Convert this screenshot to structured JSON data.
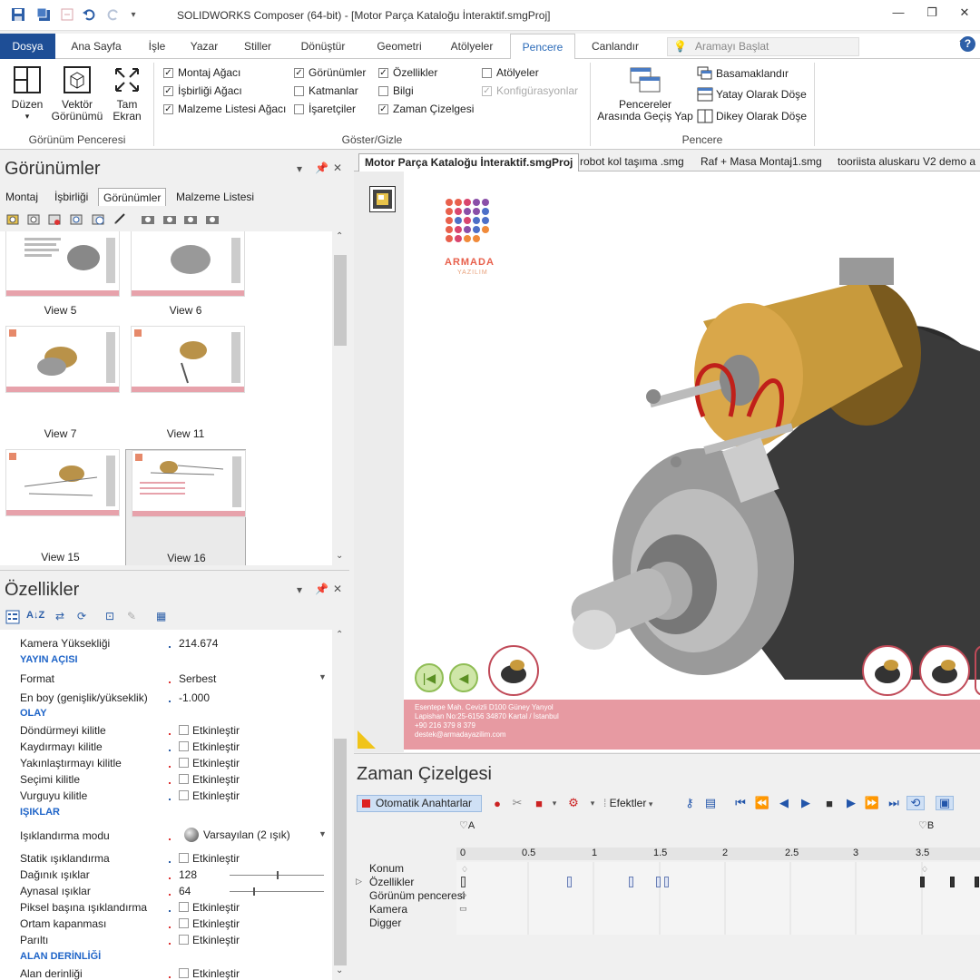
{
  "app": {
    "title": "SOLIDWORKS Composer (64-bit) - [Motor Parça Kataloğu İnteraktif.smgProj]"
  },
  "ribbon_tabs": [
    "Dosya",
    "Ana Sayfa",
    "İşle",
    "Yazar",
    "Stiller",
    "Dönüştür",
    "Geometri",
    "Atölyeler",
    "Pencere",
    "Canlandır"
  ],
  "search": {
    "placeholder": "Aramayı Başlat"
  },
  "ribbon": {
    "duzen": "Düzen",
    "vektor_1": "Vektör",
    "vektor_2": "Görünümü",
    "tam_1": "Tam",
    "tam_2": "Ekran",
    "group1": "Görünüm Penceresi",
    "checks": {
      "montaj": "Montaj Ağacı",
      "isbirligi": "İşbirliği Ağacı",
      "malzeme": "Malzeme Listesi Ağacı",
      "gorunumler": "Görünümler",
      "katmanlar": "Katmanlar",
      "isaretciler": "İşaretçiler",
      "ozellikler": "Özellikler",
      "bilgi": "Bilgi",
      "zaman": "Zaman Çizelgesi",
      "atolyeler": "Atölyeler",
      "konfig": "Konfigürasyonlar"
    },
    "group2": "Göster/Gizle",
    "gecis_1": "Pencereler",
    "gecis_2": "Arasında Geçiş Yap",
    "basamak": "Basamaklandır",
    "yatay": "Yatay Olarak Döşe",
    "dikey": "Dikey Olarak Döşe",
    "group3": "Pencere"
  },
  "views_panel": {
    "title": "Görünümler",
    "tabs": [
      "Montaj",
      "İşbirliği",
      "Görünümler",
      "Malzeme Listesi"
    ],
    "thumbs": [
      "View 5",
      "View 6",
      "View 7",
      "View 11",
      "View 15",
      "View 16"
    ]
  },
  "doc_tabs": [
    "Motor Parça Kataloğu İnteraktif.smgProj",
    "robot kol taşıma .smg",
    "Raf + Masa Montaj1.smg",
    "tooriista aluskaru V2 demo a"
  ],
  "canvas": {
    "logo_text": "ARMADA",
    "logo_sub": "YAZILIM",
    "footer_lines": [
      "Esentepe Mah. Cevizli D100 Güney Yanyol",
      "Lapishan No:25-6156 34870 Kartal / İstanbul",
      "+90 216 379 8 379",
      "destek@armadayazilim.com"
    ]
  },
  "props_panel": {
    "title": "Özellikler",
    "rows": [
      {
        "name": "Kamera Yüksekliği",
        "value": "214.674"
      },
      {
        "cat": "YAYIN AÇISI"
      },
      {
        "name": "Format",
        "value": "Serbest",
        "dropdown": true
      },
      {
        "name": "En boy (genişlik/yükseklik)",
        "value": "-1.000"
      },
      {
        "cat": "OLAY"
      },
      {
        "name": "Döndürmeyi kilitle",
        "value": "Etkinleştir",
        "check": true
      },
      {
        "name": "Kaydırmayı kilitle",
        "value": "Etkinleştir",
        "check": true
      },
      {
        "name": "Yakınlaştırmayı kilitle",
        "value": "Etkinleştir",
        "check": true
      },
      {
        "name": "Seçimi kilitle",
        "value": "Etkinleştir",
        "check": true
      },
      {
        "name": "Vurguyu kilitle",
        "value": "Etkinleştir",
        "check": true
      },
      {
        "cat": "IŞIKLAR"
      },
      {
        "name": "Işıklandırma modu",
        "value": "Varsayılan (2 ışık)",
        "dropdown": true,
        "sphere": true
      },
      {
        "name": "Statik ışıklandırma",
        "value": "Etkinleştir",
        "check": true
      },
      {
        "name": "Dağınık ışıklar",
        "value": "128",
        "slider": 0.5
      },
      {
        "name": "Aynasal ışıklar",
        "value": "64",
        "slider": 0.25
      },
      {
        "name": "Piksel başına ışıklandırma",
        "value": "Etkinleştir",
        "check": true
      },
      {
        "name": "Ortam kapanması",
        "value": "Etkinleştir",
        "check": true
      },
      {
        "name": "Parıltı",
        "value": "Etkinleştir",
        "check": true
      },
      {
        "cat": "ALAN DERİNLİĞİ"
      },
      {
        "name": "Alan derinliği",
        "value": "Etkinleştir",
        "check": true
      }
    ]
  },
  "timeline": {
    "title": "Zaman Çizelgesi",
    "autokeys": "Otomatik Anahtarlar",
    "efektler": "Efektler",
    "marker_a": "A",
    "marker_b": "B",
    "ticks": [
      "0",
      "0.5",
      "1",
      "1.5",
      "2",
      "2.5",
      "3",
      "3.5"
    ],
    "tracks": [
      "Konum",
      "Özellikler",
      "Görünüm penceresi",
      "Kamera",
      "Digger"
    ]
  }
}
